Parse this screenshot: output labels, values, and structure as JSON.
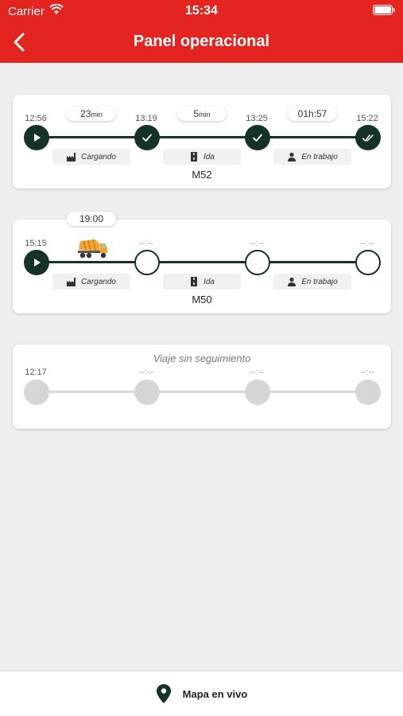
{
  "status_bar": {
    "carrier": "Carrier",
    "time": "15:34"
  },
  "nav": {
    "title": "Panel operacional",
    "back_icon": "chevron-left-icon"
  },
  "colors": {
    "brand_red": "#e4241f",
    "track_dark": "#143226",
    "inactive_grey": "#d6d6d6"
  },
  "phases": {
    "loading": {
      "label": "Cargando",
      "icon": "factory-icon"
    },
    "outbound": {
      "label": "Ida",
      "icon": "road-icon"
    },
    "working": {
      "label": "En trabajo",
      "icon": "worker-icon"
    }
  },
  "trips": [
    {
      "code": "M52",
      "times": [
        "12:56",
        "13:19",
        "13:25",
        "15:22"
      ],
      "durations": [
        {
          "value": "23",
          "unit": "min"
        },
        {
          "value": "5",
          "unit": "min"
        },
        {
          "value": "01h:57",
          "unit": ""
        }
      ],
      "node_icons": [
        "play-icon",
        "check-icon",
        "check-icon",
        "double-check-icon"
      ]
    },
    {
      "code": "M50",
      "times": [
        "15:15",
        "--:--",
        "--:--",
        "--:--"
      ],
      "eta": "19:00",
      "node_icons": [
        "play-icon",
        "",
        "",
        ""
      ],
      "vehicle_icon": "concrete-mixer-truck-icon"
    },
    {
      "code": "",
      "status_text": "Viaje sin seguimiento",
      "times": [
        "12:17",
        "--:--",
        "--:--",
        "--:--"
      ]
    }
  ],
  "bottom_bar": {
    "label": "Mapa en vivo",
    "icon": "map-pin-icon"
  }
}
